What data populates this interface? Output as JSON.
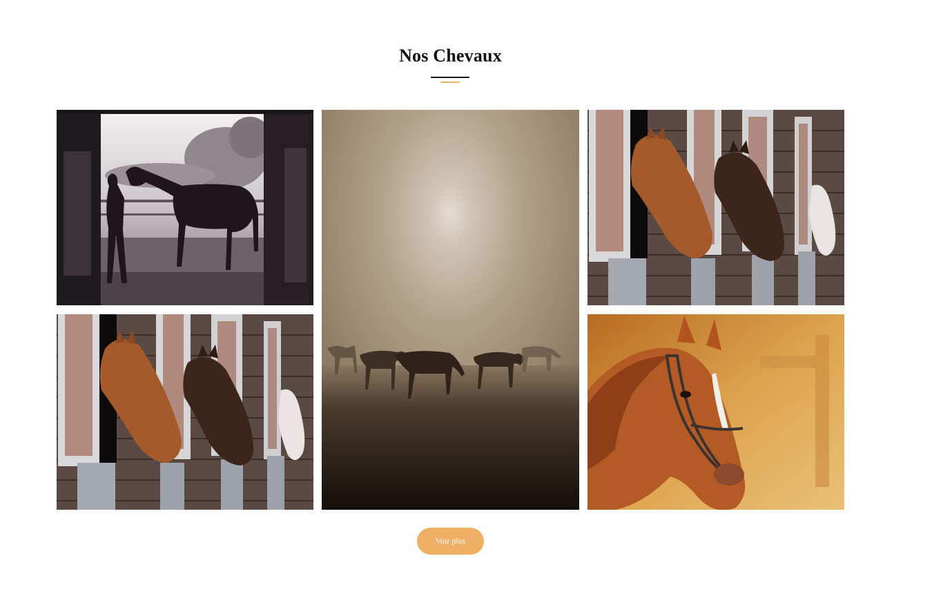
{
  "section": {
    "title": "Nos Chevaux",
    "accent_color": "#eeb064"
  },
  "gallery": {
    "items": [
      {
        "alt": "",
        "subject": "horse-silhouette-in-barn-doorway"
      },
      {
        "alt": "",
        "subject": "horses-grazing-in-misty-field"
      },
      {
        "alt": "",
        "subject": "horses-looking-out-of-stable-windows"
      },
      {
        "alt": "",
        "subject": "horses-looking-out-of-stable-windows"
      },
      {
        "alt": "",
        "subject": "chestnut-horse-portrait-with-halter"
      }
    ]
  },
  "more_button": {
    "label": "Voir plus",
    "color": "#eeb064"
  }
}
